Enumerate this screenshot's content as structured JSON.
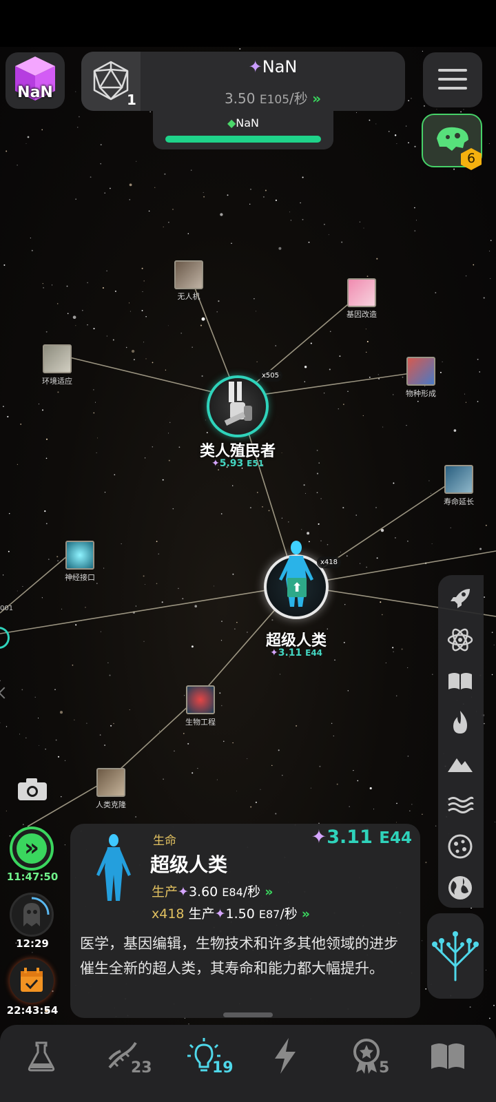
{
  "header": {
    "cube_value": "NaN",
    "level": "1",
    "currency_value": "NaN",
    "rate_mantissa": "3.50",
    "rate_exp": "E105",
    "rate_unit": "/秒",
    "sub_currency": "NaN",
    "progress": 1.0,
    "dino_badge": "6"
  },
  "nodes": {
    "drone": "无人机",
    "gene_mod": "基因改造",
    "env_adapt": "环境适应",
    "speciation": "物种形成",
    "longevity": "寿命延长",
    "neural": "神经接口",
    "bioeng": "生物工程",
    "cloning": "人类克隆",
    "cut_left": "001"
  },
  "main_nodes": {
    "colonist": {
      "name": "类人殖民者",
      "value": "5.93",
      "exp": "E51",
      "badge": "x505"
    },
    "superhuman": {
      "name": "超级人类",
      "value": "3.11",
      "exp": "E44",
      "badge": "x418"
    }
  },
  "timers": {
    "speed": "11:47:50",
    "ghost": "12:29",
    "calendar": "22:43:54"
  },
  "info": {
    "category": "生命",
    "title": "超级人类",
    "cost_value": "3.11",
    "cost_exp": "E44",
    "prod_label": "生产",
    "prod_value": "3.60",
    "prod_exp": "E84",
    "prod_unit": "/秒",
    "total_mult": "x418",
    "total_label": "生产",
    "total_value": "1.50",
    "total_exp": "E87",
    "total_unit": "/秒",
    "description": "医学，基因编辑，生物技术和许多其他领域的进步催生全新的超人类，其寿命和能力都大幅提升。"
  },
  "bottom_nav": {
    "dna_count": "23",
    "idea_count": "19",
    "medal_count": "5"
  },
  "colors": {
    "accent": "#2fd3bb",
    "progress": "#1fd38a",
    "badge_orange": "#f5b10f",
    "green_arrow": "#3ad65e"
  }
}
